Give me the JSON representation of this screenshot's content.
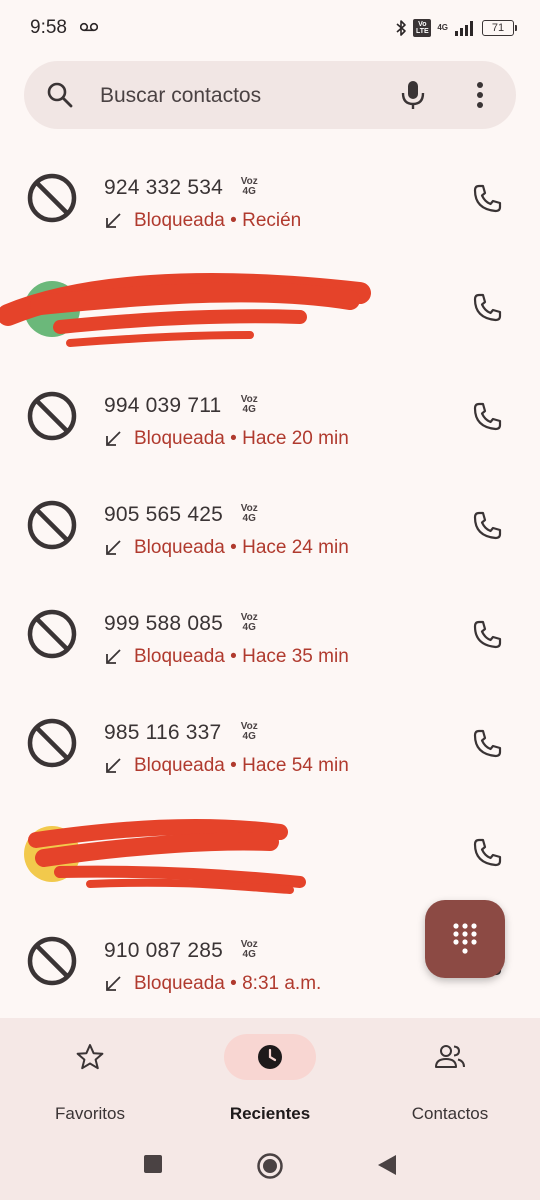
{
  "status_bar": {
    "time": "9:58",
    "volte": "Vo LTE",
    "network": "4G",
    "battery": "71"
  },
  "search": {
    "placeholder": "Buscar contactos"
  },
  "calls": [
    {
      "number": "924 332 534",
      "badge_top": "Voz",
      "badge_bottom": "4G",
      "status": "Bloqueada",
      "time": "Recién",
      "blocked": true
    },
    {
      "number": "",
      "badge_top": "",
      "badge_bottom": "",
      "status": "",
      "time": "",
      "blocked": false,
      "avatar_color": "#6bb87a",
      "redacted": true
    },
    {
      "number": "994 039 711",
      "badge_top": "Voz",
      "badge_bottom": "4G",
      "status": "Bloqueada",
      "time": "Hace 20 min",
      "blocked": true
    },
    {
      "number": "905 565 425",
      "badge_top": "Voz",
      "badge_bottom": "4G",
      "status": "Bloqueada",
      "time": "Hace 24 min",
      "blocked": true
    },
    {
      "number": "999 588 085",
      "badge_top": "Voz",
      "badge_bottom": "4G",
      "status": "Bloqueada",
      "time": "Hace 35 min",
      "blocked": true
    },
    {
      "number": "985 116 337",
      "badge_top": "Voz",
      "badge_bottom": "4G",
      "status": "Bloqueada",
      "time": "Hace 54 min",
      "blocked": true
    },
    {
      "number": "",
      "badge_top": "",
      "badge_bottom": "",
      "status": "",
      "time": "",
      "blocked": false,
      "avatar_color": "#f2c94c",
      "redacted": true
    },
    {
      "number": "910 087 285",
      "badge_top": "Voz",
      "badge_bottom": "4G",
      "status": "Bloqueada",
      "time": "8:31 a.m.",
      "blocked": true
    }
  ],
  "separator": " • ",
  "nav": {
    "favorites": "Favoritos",
    "recents": "Recientes",
    "contacts": "Contactos"
  },
  "colors": {
    "accent_text": "#b03a2e",
    "fab": "#8c4a44",
    "redaction": "#e5432a",
    "active_pill": "#f8d6d2"
  }
}
